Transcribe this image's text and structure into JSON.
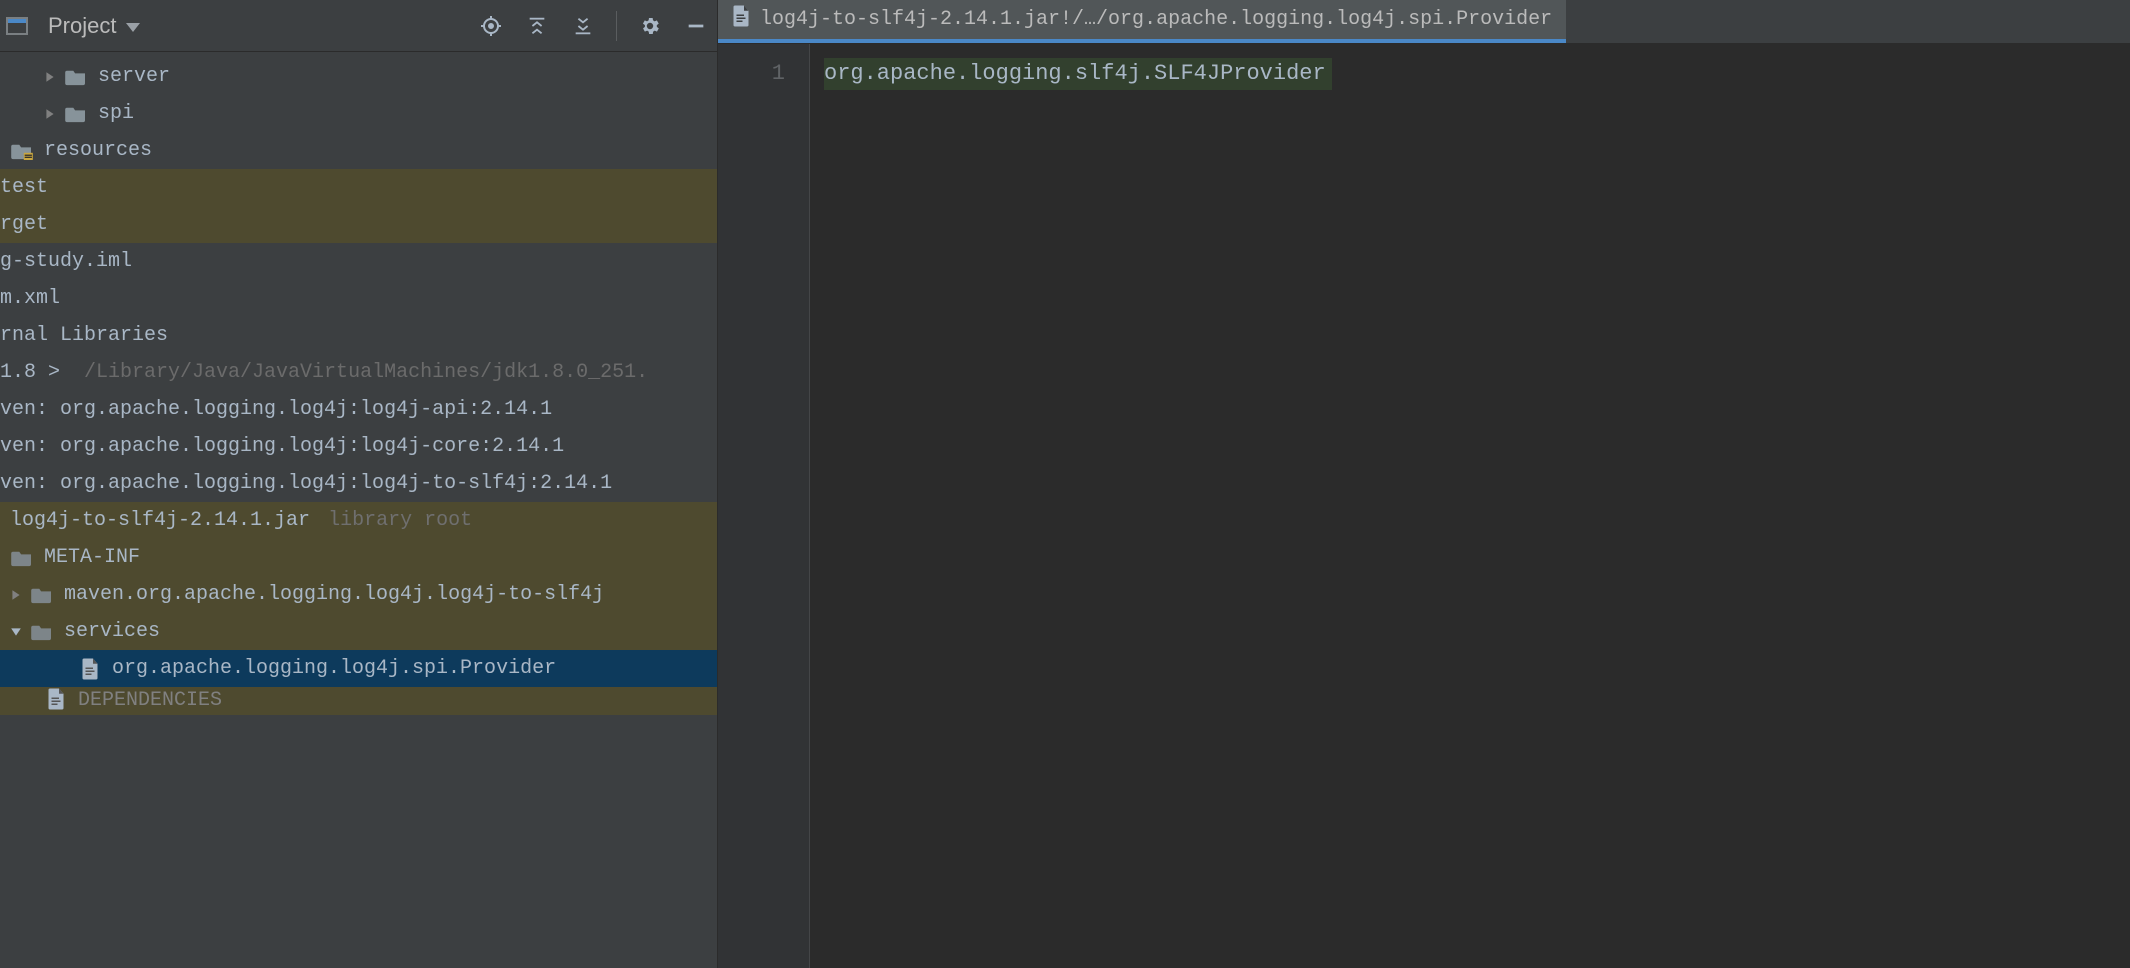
{
  "projectPanel": {
    "title": "Project",
    "toolbar": {
      "locateIcon": "locate-icon",
      "expandIcon": "expand-all-icon",
      "collapseIcon": "collapse-all-icon",
      "settingsIcon": "gear-icon",
      "hideIcon": "minimize-icon"
    },
    "tree": [
      {
        "indent": 2,
        "chevron": "right",
        "icon": "folder",
        "label": "server",
        "interactable": true
      },
      {
        "indent": 2,
        "chevron": "right",
        "icon": "folder",
        "label": "spi",
        "interactable": true
      },
      {
        "indent": 1,
        "chevron": null,
        "icon": "resources-folder",
        "label": "resources",
        "interactable": true
      },
      {
        "indent": 0,
        "chevron": null,
        "icon": null,
        "label": "test",
        "interactable": true,
        "yellow": true,
        "truncLeft": true
      },
      {
        "indent": 0,
        "chevron": null,
        "icon": null,
        "label": "rget",
        "interactable": true,
        "yellow": true,
        "flush": true
      },
      {
        "indent": 0,
        "chevron": null,
        "icon": null,
        "label": "g-study.iml",
        "interactable": true,
        "flush": true
      },
      {
        "indent": 0,
        "chevron": null,
        "icon": null,
        "label": "m.xml",
        "interactable": true,
        "flush": true
      },
      {
        "indent": 0,
        "chevron": null,
        "icon": null,
        "label": "rnal Libraries",
        "interactable": true,
        "flush": true
      },
      {
        "indent": 0,
        "chevron": null,
        "icon": null,
        "label": "1.8 >",
        "suffixDim": "/Library/Java/JavaVirtualMachines/jdk1.8.0_251.",
        "interactable": true,
        "flush": true
      },
      {
        "indent": 0,
        "chevron": null,
        "icon": null,
        "label": "ven: org.apache.logging.log4j:log4j-api:2.14.1",
        "interactable": true,
        "flush": true
      },
      {
        "indent": 0,
        "chevron": null,
        "icon": null,
        "label": "ven: org.apache.logging.log4j:log4j-core:2.14.1",
        "interactable": true,
        "flush": true
      },
      {
        "indent": 0,
        "chevron": null,
        "icon": null,
        "label": "ven: org.apache.logging.log4j:log4j-to-slf4j:2.14.1",
        "interactable": true,
        "flush": true
      },
      {
        "indent": 1,
        "chevron": null,
        "icon": null,
        "label": "log4j-to-slf4j-2.14.1.jar",
        "annot": "library root",
        "padLeft": 10,
        "interactable": true,
        "yellow": true
      },
      {
        "indent": 1,
        "chevron": null,
        "icon": "folder-grey",
        "label": "META-INF",
        "padLeft": 10,
        "interactable": true,
        "yellow": true
      },
      {
        "indent": 1,
        "chevron": "right",
        "icon": "folder-grey",
        "label": "maven.org.apache.logging.log4j.log4j-to-slf4j",
        "padLeft": 10,
        "interactable": true,
        "yellow": true
      },
      {
        "indent": 1,
        "chevron": "down",
        "icon": "folder-grey",
        "label": "services",
        "padLeft": 10,
        "interactable": true,
        "yellow": true
      },
      {
        "indent": 3,
        "chevron": null,
        "icon": "file",
        "label": "org.apache.logging.log4j.spi.Provider",
        "interactable": true,
        "selected": true
      },
      {
        "indent": 2,
        "chevron": null,
        "icon": "file",
        "label": "DEPENDENCIES",
        "interactable": true,
        "yellow": true,
        "dim": true,
        "cut": true
      }
    ]
  },
  "editor": {
    "tab": {
      "label": "log4j-to-slf4j-2.14.1.jar!/…/org.apache.logging.log4j.spi.Provider"
    },
    "gutter": {
      "line1": "1"
    },
    "content": {
      "line1": "org.apache.logging.slf4j.SLF4JProvider"
    }
  }
}
